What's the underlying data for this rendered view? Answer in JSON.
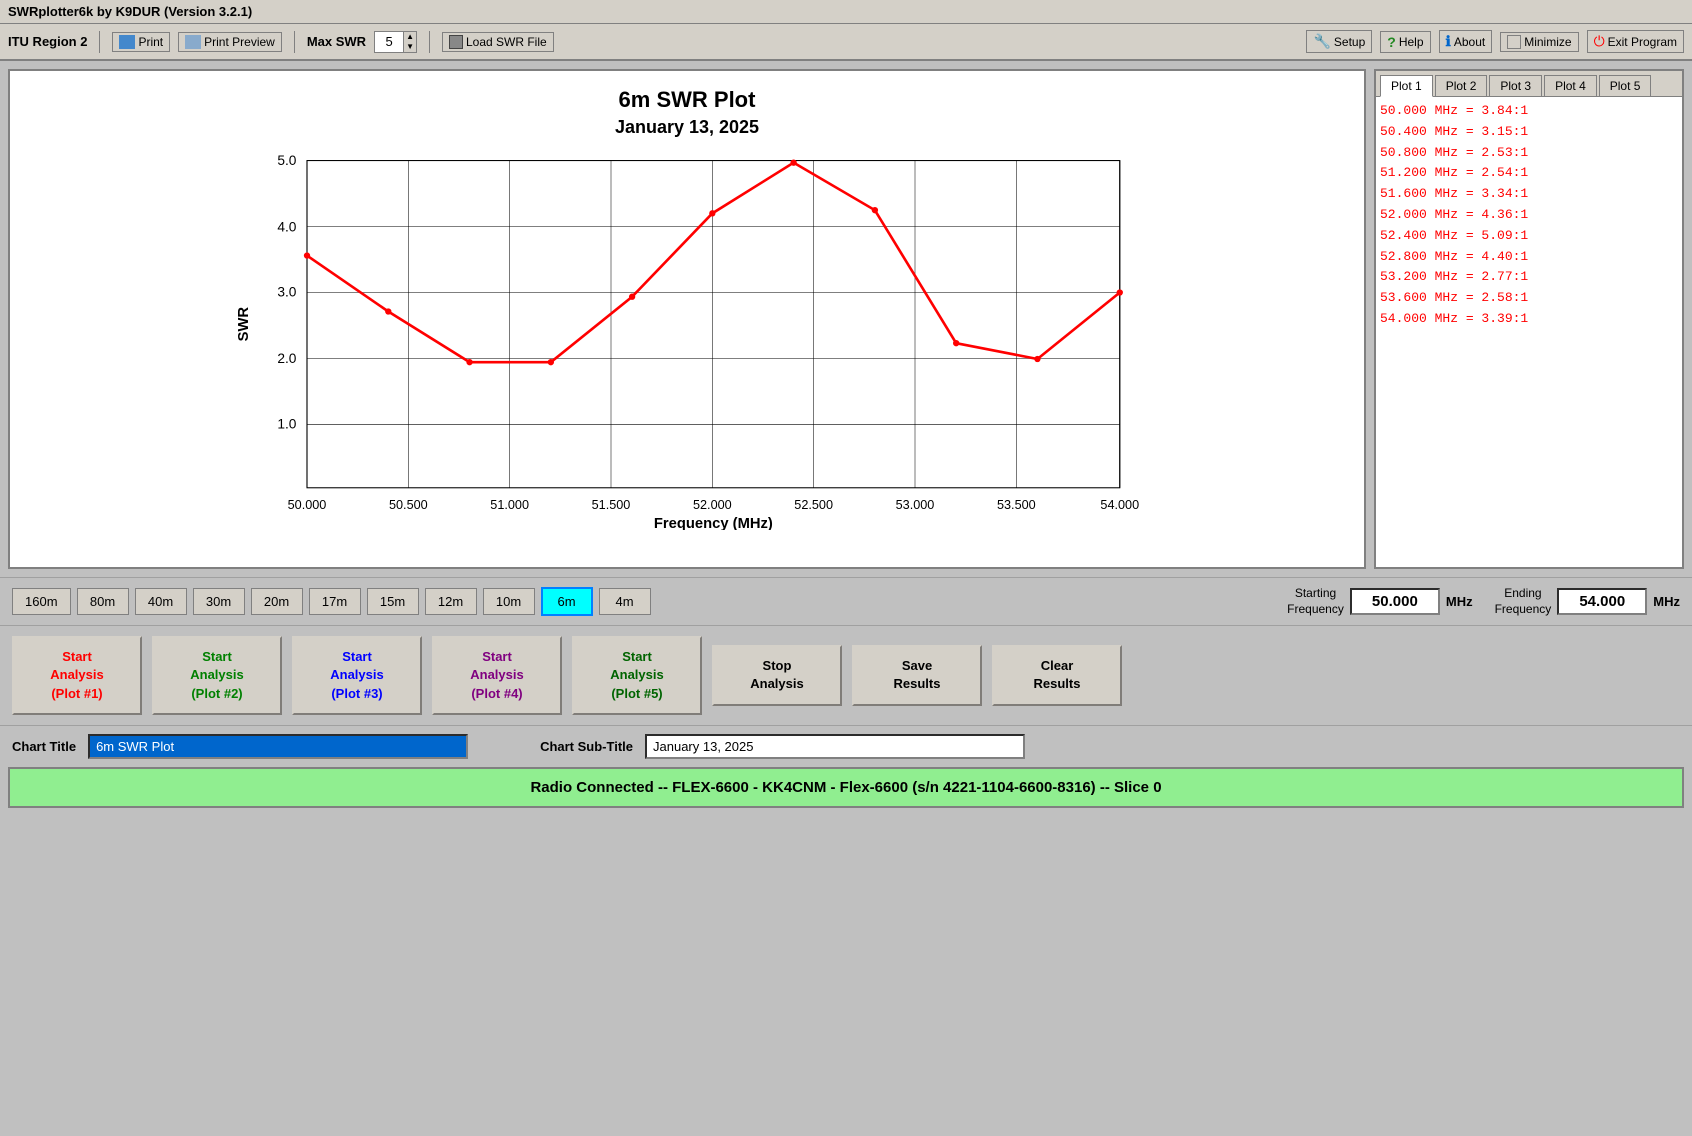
{
  "titleBar": {
    "title": "SWRplotter6k by K9DUR (Version 3.2.1)"
  },
  "toolbar": {
    "region": "ITU Region 2",
    "print": "Print",
    "printPreview": "Print Preview",
    "maxSwr": "Max SWR",
    "maxSwrValue": "5",
    "loadSwrFile": "Load SWR File",
    "setup": "Setup",
    "help": "Help",
    "about": "About",
    "minimize": "Minimize",
    "exitProgram": "Exit Program"
  },
  "chart": {
    "title": "6m SWR Plot",
    "subtitle": "January 13, 2025",
    "xLabel": "Frequency (MHz)",
    "yLabel": "SWR",
    "xMin": 50.0,
    "xMax": 54.0,
    "yMin": 1.0,
    "yMax": 5.0,
    "xTicks": [
      "50.000",
      "50.500",
      "51.000",
      "51.500",
      "52.000",
      "52.500",
      "53.000",
      "53.500",
      "54.000"
    ],
    "yTicks": [
      "1.0",
      "2.0",
      "3.0",
      "4.0",
      "5.0"
    ]
  },
  "plotTabs": [
    {
      "label": "Plot 1",
      "active": true
    },
    {
      "label": "Plot 2",
      "active": false
    },
    {
      "label": "Plot 3",
      "active": false
    },
    {
      "label": "Plot 4",
      "active": false
    },
    {
      "label": "Plot 5",
      "active": false
    }
  ],
  "dataRows": [
    "50.000 MHz = 3.84:1",
    "50.400 MHz = 3.15:1",
    "50.800 MHz = 2.53:1",
    "51.200 MHz = 2.54:1",
    "51.600 MHz = 3.34:1",
    "52.000 MHz = 4.36:1",
    "52.400 MHz = 5.09:1",
    "52.800 MHz = 4.40:1",
    "53.200 MHz = 2.77:1",
    "53.600 MHz = 2.58:1",
    "54.000 MHz = 3.39:1"
  ],
  "bands": [
    {
      "label": "160m",
      "active": false
    },
    {
      "label": "80m",
      "active": false
    },
    {
      "label": "40m",
      "active": false
    },
    {
      "label": "30m",
      "active": false
    },
    {
      "label": "20m",
      "active": false
    },
    {
      "label": "17m",
      "active": false
    },
    {
      "label": "15m",
      "active": false
    },
    {
      "label": "12m",
      "active": false
    },
    {
      "label": "10m",
      "active": false
    },
    {
      "label": "6m",
      "active": true
    },
    {
      "label": "4m",
      "active": false
    }
  ],
  "frequency": {
    "startingLabel": "Starting\nFrequency",
    "startingValue": "50.000",
    "startingUnit": "MHz",
    "endingLabel": "Ending\nFrequency",
    "endingValue": "54.000",
    "endingUnit": "MHz"
  },
  "analysisButtons": [
    {
      "label": "Start\nAnalysis\n(Plot #1)",
      "color": "red"
    },
    {
      "label": "Start\nAnalysis\n(Plot #2)",
      "color": "green"
    },
    {
      "label": "Start\nAnalysis\n(Plot #3)",
      "color": "blue"
    },
    {
      "label": "Start\nAnalysis\n(Plot #4)",
      "color": "purple"
    },
    {
      "label": "Start\nAnalysis\n(Plot #5)",
      "color": "dark-green"
    },
    {
      "label": "Stop\nAnalysis",
      "color": "black"
    },
    {
      "label": "Save\nResults",
      "color": "black"
    },
    {
      "label": "Clear\nResults",
      "color": "black"
    }
  ],
  "chartTitleArea": {
    "titleLabel": "Chart Title",
    "titleValue": "6m SWR Plot",
    "subtitleLabel": "Chart Sub-Title",
    "subtitleValue": "January 13, 2025"
  },
  "statusBar": {
    "text": "Radio Connected -- FLEX-6600 - KK4CNM - Flex-6600  (s/n 4221-1104-6600-8316) -- Slice 0"
  }
}
